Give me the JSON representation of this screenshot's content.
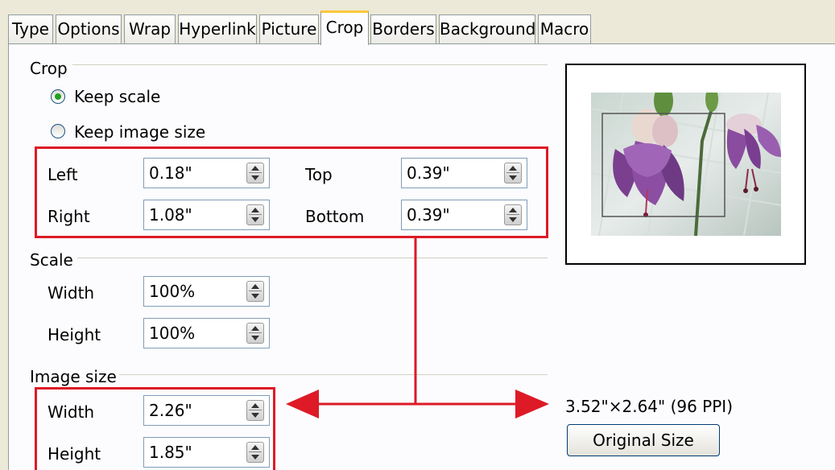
{
  "tabs": [
    "Type",
    "Options",
    "Wrap",
    "Hyperlink",
    "Picture",
    "Crop",
    "Borders",
    "Background",
    "Macro"
  ],
  "active_tab": "Crop",
  "crop": {
    "section_label": "Crop",
    "keep_scale": "Keep scale",
    "keep_image_size": "Keep image size",
    "selected": "Keep scale",
    "left_label": "Left",
    "left_value": "0.18\"",
    "right_label": "Right",
    "right_value": "1.08\"",
    "top_label": "Top",
    "top_value": "0.39\"",
    "bottom_label": "Bottom",
    "bottom_value": "0.39\""
  },
  "scale": {
    "section_label": "Scale",
    "width_label": "Width",
    "width_value": "100%",
    "height_label": "Height",
    "height_value": "100%"
  },
  "image_size": {
    "section_label": "Image size",
    "width_label": "Width",
    "width_value": "2.26\"",
    "height_label": "Height",
    "height_value": "1.85\""
  },
  "original_info": "3.52\"×2.64\" (96 PPI)",
  "original_size_button": "Original Size",
  "colors": {
    "highlight_red": "#dd1a26",
    "tab_accent": "#ffc73c",
    "dialog_bg": "#fcfcfe"
  }
}
